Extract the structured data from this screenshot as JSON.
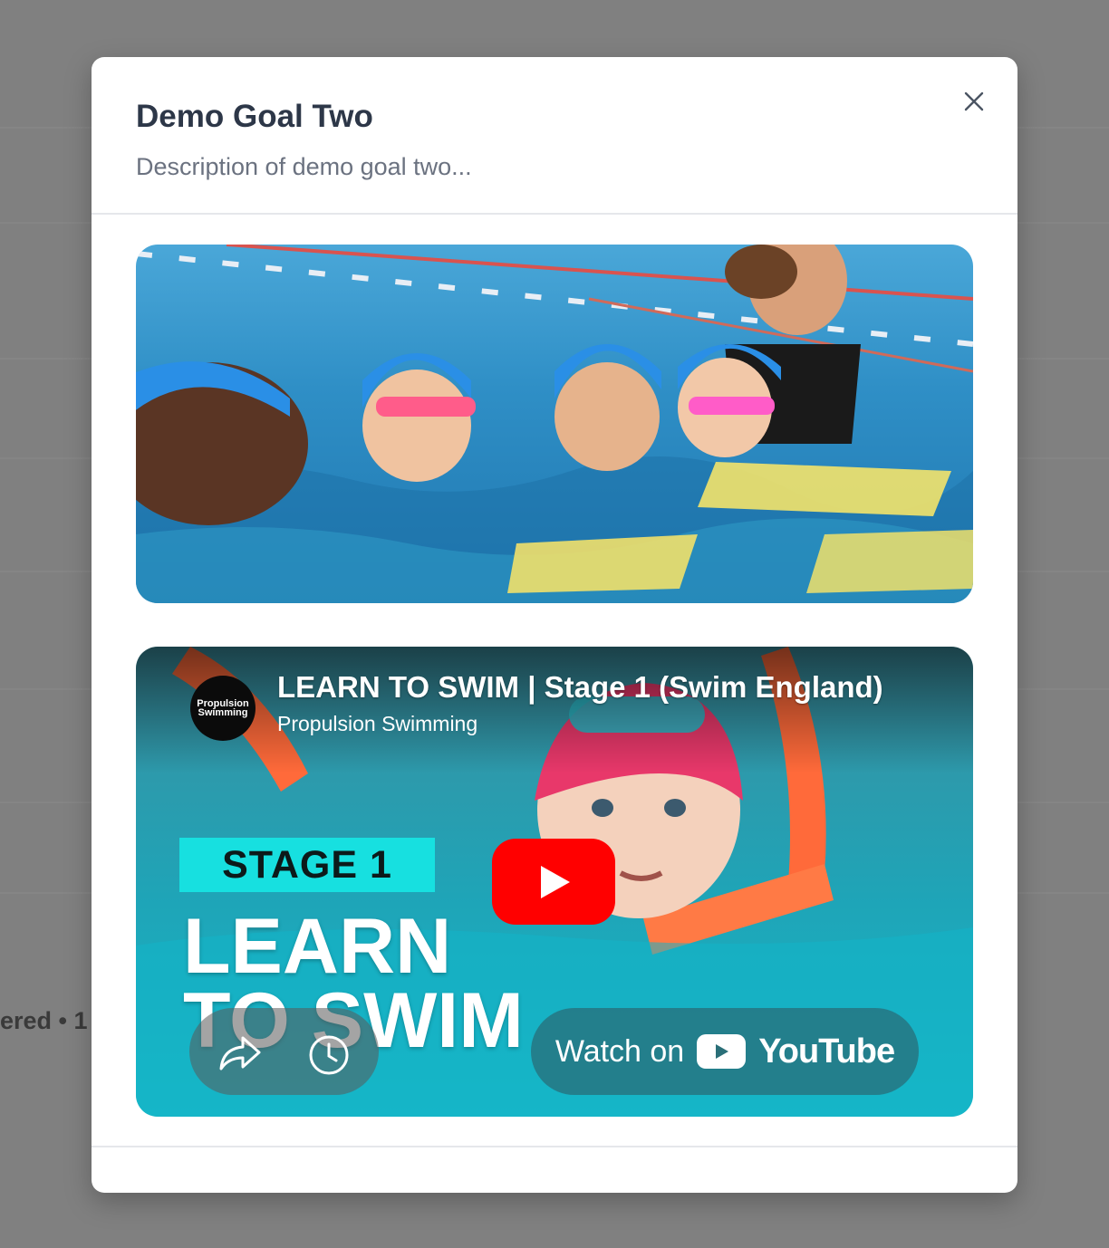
{
  "background": {
    "status_fragment": "ered • 1 "
  },
  "modal": {
    "title": "Demo Goal Two",
    "description": "Description of demo goal two...",
    "close_icon": "close-icon"
  },
  "goal_image": {
    "alt": "Children in swimming caps learning to swim with an instructor in a pool",
    "icon": "photo"
  },
  "video": {
    "title": "LEARN TO SWIM | Stage 1 (Swim England)",
    "channel": "Propulsion Swimming",
    "channel_avatar_text": "Propulsion Swimming",
    "thumbnail_badge": "STAGE 1",
    "thumbnail_headline_line1": "LEARN",
    "thumbnail_headline_line2": "TO SWIM",
    "watch_on": "Watch on",
    "youtube_word": "YouTube",
    "play_icon": "play-icon",
    "share_icon": "share-icon",
    "watch_later_icon": "clock-icon"
  },
  "colors": {
    "youtube_red": "#ff0000",
    "stage_badge": "#17e0e0",
    "title_text": "#2d3748",
    "description_text": "#6b7280"
  }
}
